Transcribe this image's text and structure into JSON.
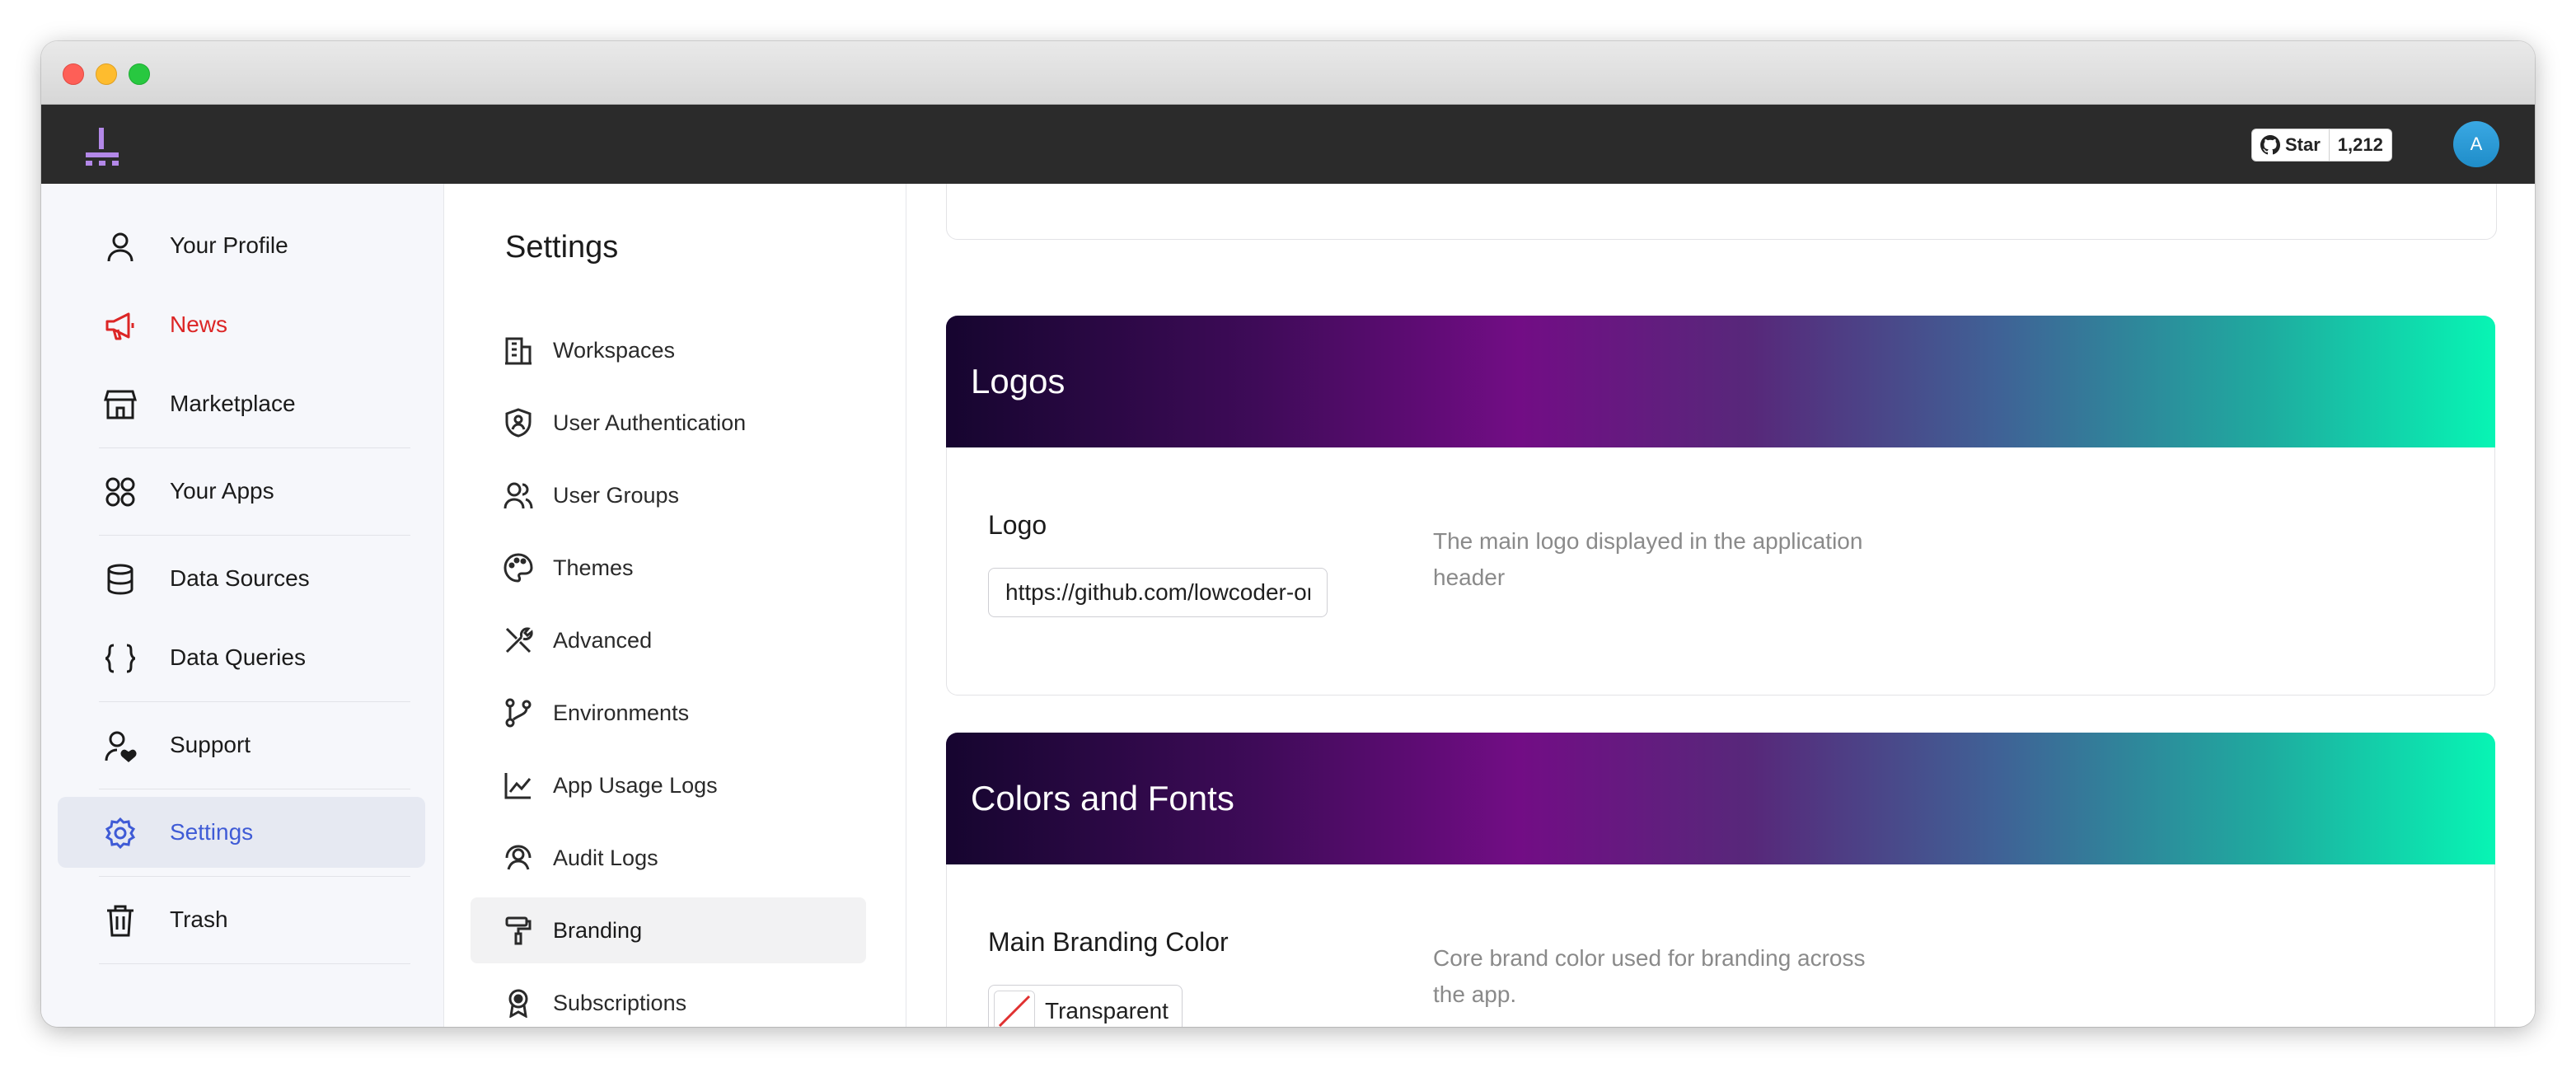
{
  "header": {
    "github": {
      "star_label": "Star",
      "star_count": "1,212"
    },
    "avatar_initial": "A"
  },
  "sidebar": {
    "items": [
      {
        "label": "Your Profile",
        "icon": "user-icon"
      },
      {
        "label": "News",
        "icon": "megaphone-icon",
        "color": "#dc2626"
      },
      {
        "label": "Marketplace",
        "icon": "store-icon"
      },
      {
        "label": "Your Apps",
        "icon": "apps-grid-icon"
      },
      {
        "label": "Data Sources",
        "icon": "database-icon"
      },
      {
        "label": "Data Queries",
        "icon": "braces-icon"
      },
      {
        "label": "Support",
        "icon": "user-heart-icon"
      },
      {
        "label": "Settings",
        "icon": "gear-icon",
        "active": true,
        "color": "#3f5bd6"
      },
      {
        "label": "Trash",
        "icon": "trash-icon"
      }
    ]
  },
  "settings": {
    "title": "Settings",
    "items": [
      {
        "label": "Workspaces",
        "icon": "building-icon"
      },
      {
        "label": "User Authentication",
        "icon": "shield-user-icon"
      },
      {
        "label": "User Groups",
        "icon": "users-icon"
      },
      {
        "label": "Themes",
        "icon": "palette-icon"
      },
      {
        "label": "Advanced",
        "icon": "tools-icon"
      },
      {
        "label": "Environments",
        "icon": "git-branch-icon"
      },
      {
        "label": "App Usage Logs",
        "icon": "line-chart-icon"
      },
      {
        "label": "Audit Logs",
        "icon": "user-circle-icon"
      },
      {
        "label": "Branding",
        "icon": "paint-roller-icon",
        "active": true
      },
      {
        "label": "Subscriptions",
        "icon": "badge-icon"
      }
    ]
  },
  "main": {
    "logos": {
      "title": "Logos",
      "field_label": "Logo",
      "value": "https://github.com/lowcoder-org/lowcoder",
      "description": "The main logo displayed in the application header"
    },
    "colors_fonts": {
      "title": "Colors and Fonts",
      "field_label": "Main Branding Color",
      "color_value": "Transparent",
      "description": "Core brand color used for branding across the app."
    }
  },
  "colors": {
    "topbar": "#2b2b2b",
    "accent": "#3f5bd6",
    "news": "#dc2626",
    "gradient_start": "#16052f",
    "gradient_end": "#07f5b4"
  }
}
